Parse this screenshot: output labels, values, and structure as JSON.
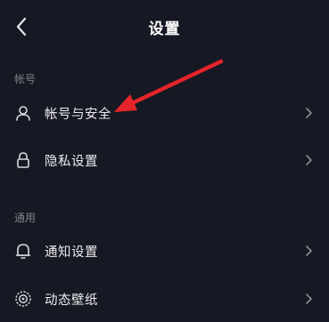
{
  "header": {
    "title": "设置",
    "back_icon": "chevron-left-icon"
  },
  "sections": [
    {
      "label": "帐号",
      "items": [
        {
          "label": "帐号与安全",
          "icon": "person-icon"
        },
        {
          "label": "隐私设置",
          "icon": "lock-icon"
        }
      ]
    },
    {
      "label": "通用",
      "items": [
        {
          "label": "通知设置",
          "icon": "bell-icon"
        },
        {
          "label": "动态壁纸",
          "icon": "wallpaper-icon"
        }
      ]
    }
  ],
  "colors": {
    "background": "#161823",
    "text": "#ececee",
    "muted": "#7d7f88",
    "annotation_arrow": "#e5242a"
  }
}
